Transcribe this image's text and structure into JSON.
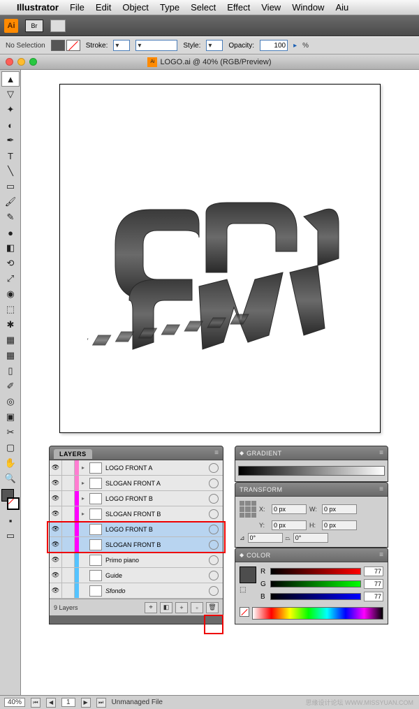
{
  "menubar": {
    "app": "Illustrator",
    "items": [
      "File",
      "Edit",
      "Object",
      "Type",
      "Select",
      "Effect",
      "View",
      "Window",
      "Aiu"
    ]
  },
  "app_icon": "Ai",
  "br_icon": "Br",
  "options": {
    "selection": "No Selection",
    "stroke_label": "Stroke:",
    "stroke_value": "",
    "style_label": "Style:",
    "opacity_label": "Opacity:",
    "opacity_value": "100",
    "percent": "%"
  },
  "document": {
    "title": "LOGO.ai @ 40% (RGB/Preview)"
  },
  "layers": {
    "title": "LAYERS",
    "rows": [
      {
        "name": "LOGO FRONT A",
        "color": "#ff7dd1",
        "highlighted": false,
        "expand": true
      },
      {
        "name": "SLOGAN FRONT A",
        "color": "#ff7dd1",
        "highlighted": false,
        "expand": true
      },
      {
        "name": "LOGO FRONT B",
        "color": "#ff00ff",
        "highlighted": false,
        "expand": true
      },
      {
        "name": "SLOGAN FRONT B",
        "color": "#ff00ff",
        "highlighted": false,
        "expand": true
      },
      {
        "name": "LOGO FRONT B",
        "color": "#ff00ff",
        "highlighted": true,
        "expand": false
      },
      {
        "name": "SLOGAN FRONT B",
        "color": "#ff00ff",
        "highlighted": true,
        "expand": false
      },
      {
        "name": "Primo piano",
        "color": "#55c3ff",
        "highlighted": false,
        "expand": false
      },
      {
        "name": "Guide",
        "color": "#55c3ff",
        "highlighted": false,
        "expand": false
      },
      {
        "name": "Sfondo",
        "color": "#55c3ff",
        "highlighted": false,
        "expand": false,
        "italic": true
      }
    ],
    "footer": "9 Layers"
  },
  "gradient": {
    "title": "GRADIENT"
  },
  "transform": {
    "title": "TRANSFORM",
    "x_label": "X:",
    "x_val": "0 px",
    "y_label": "Y:",
    "y_val": "0 px",
    "w_label": "W:",
    "w_val": "0 px",
    "h_label": "H:",
    "h_val": "0 px",
    "angle": "0°",
    "shear": "0°"
  },
  "color": {
    "title": "COLOR",
    "r_label": "R",
    "r_val": "77",
    "g_label": "G",
    "g_val": "77",
    "b_label": "B",
    "b_val": "77"
  },
  "status": {
    "zoom": "40%",
    "page": "1",
    "unmanaged": "Unmanaged File"
  },
  "watermark": "思缘设计论坛 WWW.MISSYUAN.COM"
}
